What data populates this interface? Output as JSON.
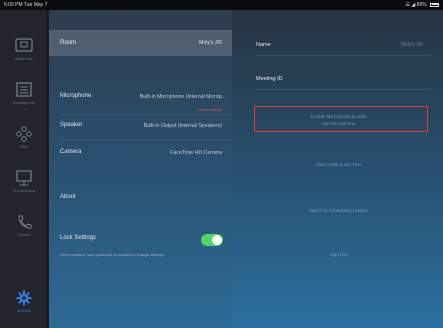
{
  "status_bar": {
    "time_date": "6:09 PM  Tue May 7",
    "right": "☱ ◢ 89%"
  },
  "sidebar": {
    "items": [
      {
        "label": "Meet Now",
        "icon": "meet-now-icon"
      },
      {
        "label": "Meeting List",
        "icon": "meeting-list-icon"
      },
      {
        "label": "Dial",
        "icon": "dial-icon"
      },
      {
        "label": "Presentation",
        "icon": "presentation-icon"
      },
      {
        "label": "Phone",
        "icon": "phone-icon"
      },
      {
        "label": "Settings",
        "icon": "gear-icon"
      }
    ],
    "active_index": 5,
    "active_color": "#2f7ad9"
  },
  "settings": {
    "room": {
      "label": "Room",
      "value": "Moly's ZR"
    },
    "microphone": {
      "label": "Microphone",
      "value": "Built-in Microphone (Internal Microp...",
      "warning": "Expand settings"
    },
    "speaker": {
      "label": "Speaker",
      "value": "Built-in Output (Internal Speakers)"
    },
    "camera": {
      "label": "Camera",
      "value": "FaceTime HD Camera"
    },
    "about": {
      "label": "About"
    },
    "lock": {
      "label": "Lock Settings",
      "enabled": true,
      "description": "When enabled, room passcode is required to change settings."
    }
  },
  "right_panel": {
    "name": {
      "label": "Name",
      "value": "Moly's ZR"
    },
    "meeting_id": {
      "label": "Meeting ID",
      "value": ""
    },
    "actions": [
      {
        "label": "Enable Microphone & Less",
        "sub": "Sort microphone"
      },
      {
        "label": "Start Audio & Mic Test"
      },
      {
        "label": "Switch to Scheduling Display"
      },
      {
        "label": "Sign Out"
      }
    ],
    "highlight_color": "#e23a2d"
  }
}
